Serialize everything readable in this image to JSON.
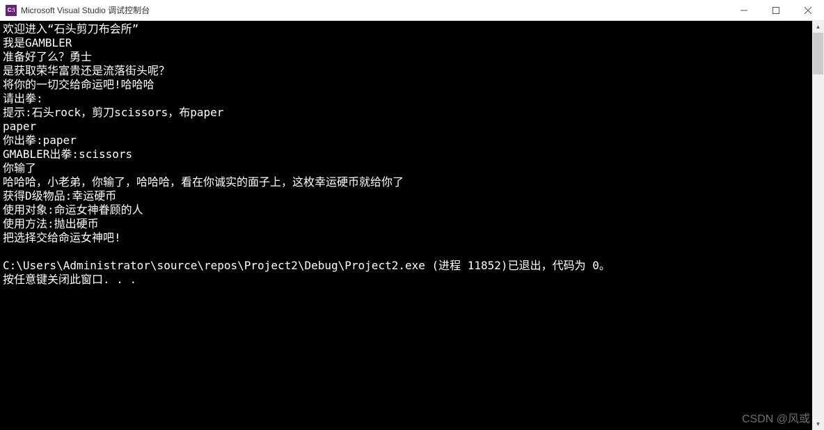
{
  "window": {
    "icon_text": "C:\\",
    "title": "Microsoft Visual Studio 调试控制台"
  },
  "console": {
    "lines": [
      "欢迎进入“石头剪刀布会所”",
      "我是GAMBLER",
      "准备好了么？勇士",
      "是获取荣华富贵还是流落街头呢？",
      "将你的一切交给命运吧!哈哈哈",
      "请出拳:",
      "提示:石头rock，剪刀scissors，布paper",
      "paper",
      "你出拳:paper",
      "GMABLER出拳:scissors",
      "你输了",
      "哈哈哈，小老弟，你输了，哈哈哈，看在你诚实的面子上，这枚幸运硬币就给你了",
      "获得D级物品:幸运硬币",
      "使用对象:命运女神眷顾的人",
      "使用方法:抛出硬币",
      "把选择交给命运女神吧!",
      "",
      "C:\\Users\\Administrator\\source\\repos\\Project2\\Debug\\Project2.exe (进程 11852)已退出，代码为 0。",
      "按任意键关闭此窗口. . ."
    ]
  },
  "watermark": "CSDN @风或"
}
